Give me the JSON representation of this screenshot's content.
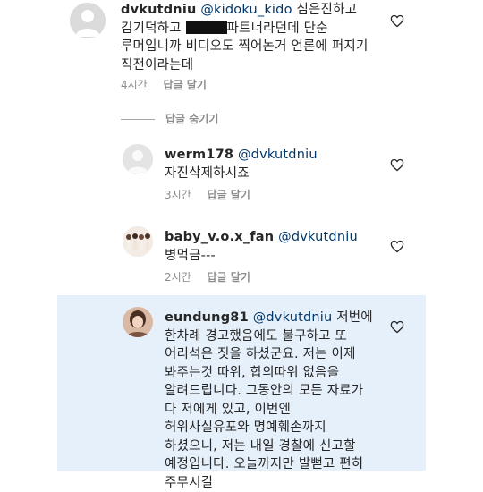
{
  "comments": [
    {
      "username": "dvkutdniu",
      "mention": "@kidoku_kido",
      "text_line1": " 심은진하고",
      "text_line2a": "김기덕하고 ",
      "text_line2b": "파트너라던데 단순",
      "text_line3": "루머입니까 비디오도 찍어논거 언론에 퍼지기",
      "text_line4": "직전이라는데",
      "time": "4시간",
      "reply_label": "답글 달기"
    },
    {
      "username": "werm178",
      "mention": "@dvkutdniu",
      "text_line1": "자진삭제하시죠",
      "time": "3시간",
      "reply_label": "답글 달기"
    },
    {
      "username": "baby_v.o.x_fan",
      "mention": "@dvkutdniu",
      "text_line1": "병먹금---",
      "time": "2시간",
      "reply_label": "답글 달기"
    },
    {
      "username": "eundung81",
      "mention": "@dvkutdniu",
      "lines": [
        " 저번에",
        "한차례 경고했음에도 불구하고 또",
        "어리석은 짓을 하셨군요. 저는 이제",
        "봐주는것 따위, 합의따위 없음을",
        "알려드립니다. 그동안의 모든 자료가",
        "다 저에게 있고, 이번엔",
        "허위사실유포와 명예훼손까지",
        "하셨으니, 저는 내일 경찰에 신고할",
        "예정입니다. 오늘까지만 발뻗고 편히",
        "주무시길"
      ]
    }
  ],
  "hide_replies_label": "답글 숨기기",
  "colors": {
    "mention": "#00376b",
    "meta": "#8e8e8e",
    "highlight": "#e6f0fb"
  },
  "icons": [
    "heart-icon"
  ]
}
